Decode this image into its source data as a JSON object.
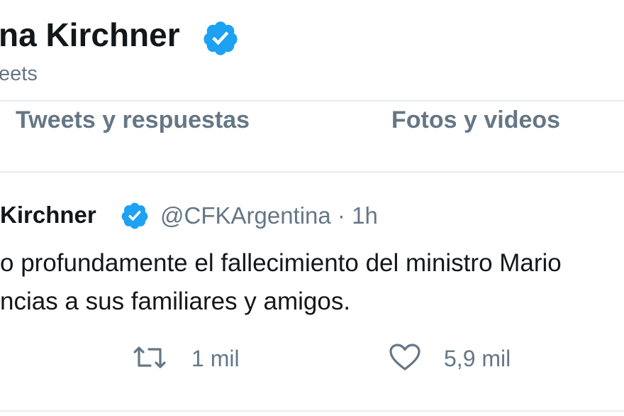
{
  "profile": {
    "name": "na Kirchner",
    "tweet_count_label": "eets"
  },
  "tabs": [
    {
      "label": "Tweets y respuestas"
    },
    {
      "label": "Fotos y videos"
    }
  ],
  "tweet": {
    "author_name": "Kirchner",
    "author_meta": "@CFKArgentina · 1h",
    "lines": [
      "o profundamente el fallecimiento del ministro Mario",
      "ncias a sus familiares y amigos."
    ],
    "retweets": "1 mil",
    "likes": "5,9 mil"
  },
  "colors": {
    "verified": "#1da1f2",
    "secondary_text": "#657786",
    "divider": "#e6ecf0"
  },
  "icons": [
    "verified-badge-icon",
    "retweet-icon",
    "like-heart-icon"
  ]
}
